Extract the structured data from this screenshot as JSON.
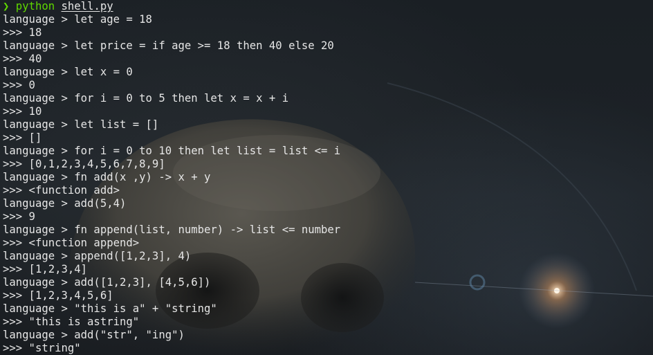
{
  "shell_prompt": {
    "arrow": "❯",
    "command": "python",
    "argument": "shell.py"
  },
  "lines": [
    "language > let age = 18",
    ">>> 18",
    "language > let price = if age >= 18 then 40 else 20",
    ">>> 40",
    "language > let x = 0",
    ">>> 0",
    "language > for i = 0 to 5 then let x = x + i",
    ">>> 10",
    "language > let list = []",
    ">>> []",
    "language > for i = 0 to 10 then let list = list <= i",
    ">>> [0,1,2,3,4,5,6,7,8,9]",
    "language > fn add(x ,y) -> x + y",
    ">>> <function add>",
    "language > add(5,4)",
    ">>> 9",
    "language > fn append(list, number) -> list <= number",
    ">>> <function append>",
    "language > append([1,2,3], 4)",
    ">>> [1,2,3,4]",
    "language > add([1,2,3], [4,5,6])",
    ">>> [1,2,3,4,5,6]",
    "language > \"this is a\" + \"string\"",
    ">>> \"this is astring\"",
    "language > add(\"str\", \"ing\")",
    ">>> \"string\""
  ],
  "colors": {
    "background": "#1b1f24",
    "text": "#e6e6e6",
    "prompt_green": "#5fd700"
  },
  "wallpaper": {
    "subject": "skull-image",
    "accent": "lens-flare"
  }
}
